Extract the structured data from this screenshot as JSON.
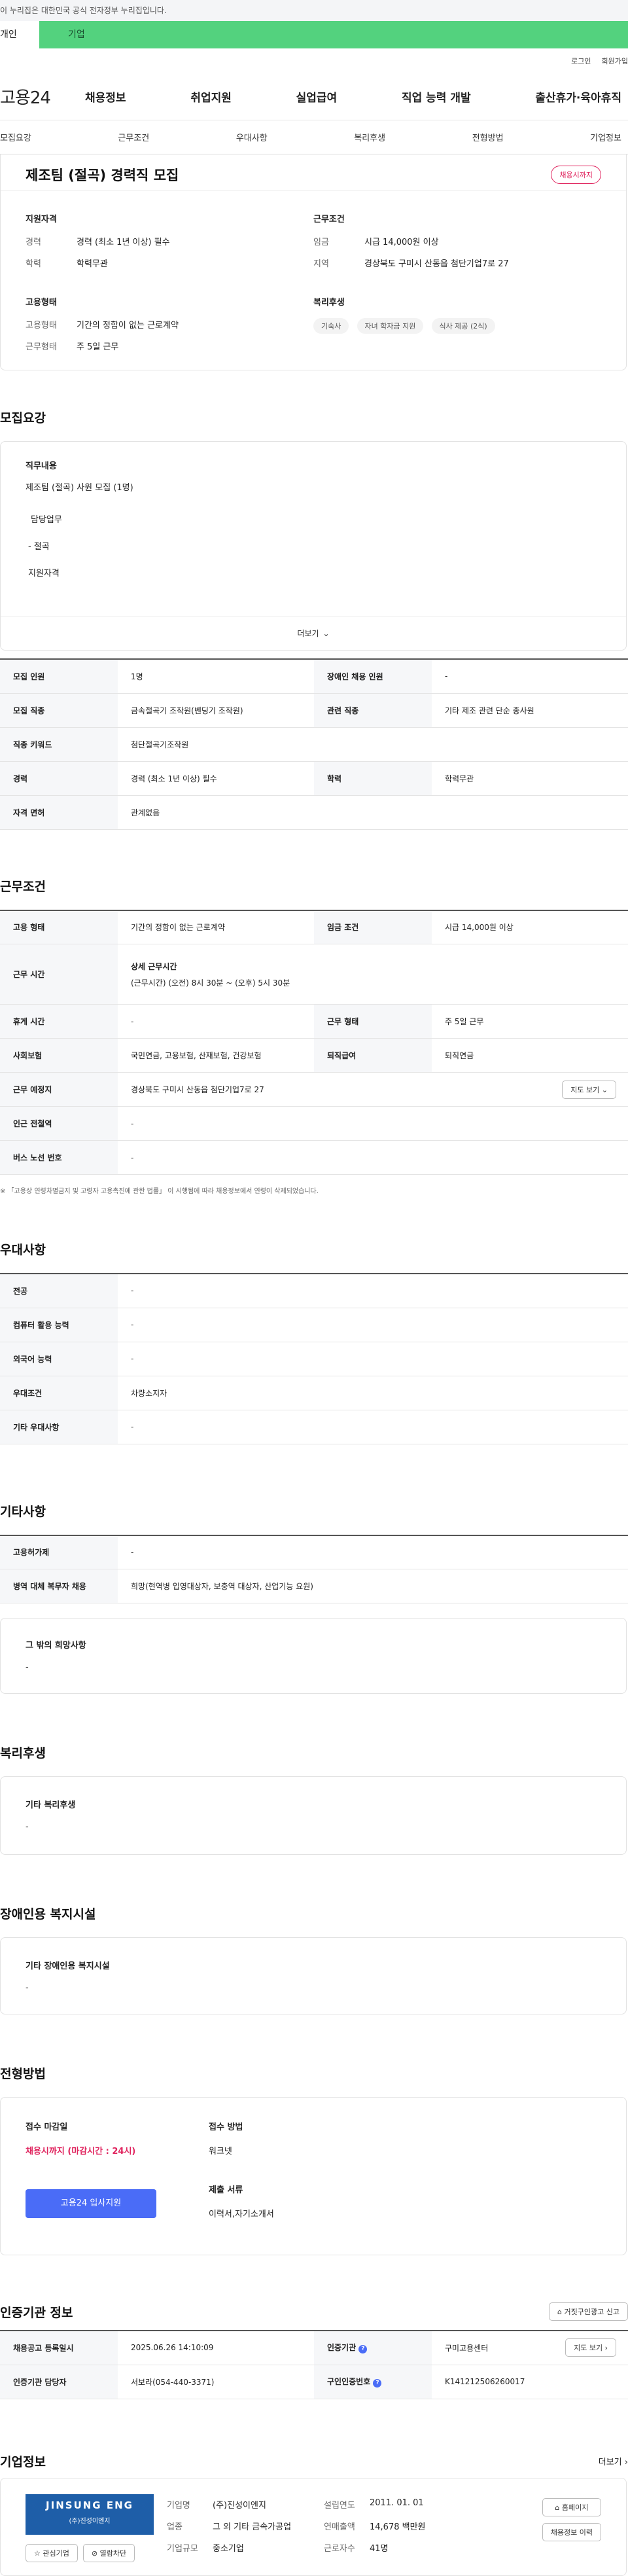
{
  "gov_banner": "이 누리집은 대한민국 공식 전자정부 누리집입니다.",
  "user_tabs": [
    "개인",
    "기업"
  ],
  "top_links": [
    "로그인",
    "회원가입"
  ],
  "logo": "고용24",
  "gnb": [
    "채용정보",
    "취업지원",
    "실업급여",
    "직업 능력 개발",
    "출산휴가·육아휴직"
  ],
  "page_tabs": [
    "모집요강",
    "근무조건",
    "우대사항",
    "복리후생",
    "전형방법",
    "기업정보"
  ],
  "summary": {
    "title": "제조팀 (절곡) 경력직 모집",
    "status": "채용시까지",
    "qual_title": "지원자격",
    "qual_rows": [
      [
        "경력",
        "경력 (최소 1년 이상) 필수"
      ],
      [
        "학력",
        "학력무관"
      ]
    ],
    "emp_title": "고용형태",
    "emp_rows": [
      [
        "고용형태",
        "기간의 정함이 없는 근로계약"
      ],
      [
        "근무형태",
        "주 5일 근무"
      ]
    ],
    "cond_title": "근무조건",
    "cond_rows": [
      [
        "임금",
        "시급 14,000원 이상"
      ],
      [
        "지역",
        "경상북도 구미시 산동읍 첨단기업7로 27"
      ]
    ],
    "welfare_title": "복리후생",
    "welfare_badges": [
      "기숙사",
      "자녀 학자금 지원",
      "식사 제공 (2식)"
    ]
  },
  "recruit": {
    "title": "모집요강",
    "duty_title": "직무내용",
    "duty_text": "제조팀 (절곡) 사원 모집  (1명)",
    "duty_lines": [
      "담당업무",
      "- 절곡",
      "지원자격"
    ],
    "more": "더보기",
    "rows": [
      [
        "모집 인원",
        "1명",
        "장애인 채용 인원",
        "-"
      ],
      [
        "모집 직종",
        "금속절곡기 조작원(벤딩기 조작원)",
        "관련 직종",
        "기타 제조 관련 단순 종사원"
      ],
      [
        "직종 키워드",
        "첨단절곡기조작원"
      ],
      [
        "경력",
        "경력 (최소 1년 이상) 필수",
        "학력",
        "학력무관"
      ],
      [
        "자격 면허",
        "관계없음"
      ]
    ]
  },
  "work": {
    "title": "근무조건",
    "row1": [
      "고용 형태",
      "기간의 정함이 없는 근로계약",
      "임금 조건",
      "시급 14,000원 이상"
    ],
    "hours_label": "근무 시간",
    "hours_title": "상세 근무시간",
    "hours_text": "(근무시간) (오전) 8시 30분 ~ (오후) 5시 30분",
    "row3": [
      "휴게 시간",
      "-",
      "근무 형태",
      "주 5일 근무"
    ],
    "row4": [
      "사회보험",
      "국민연금, 고용보험, 산재보험, 건강보험",
      "퇴직급여",
      "퇴직연금"
    ],
    "place_label": "근무 예정지",
    "place_value": "경상북도 구미시 산동읍 첨단기업7로 27",
    "map_btn": "지도 보기",
    "row6": [
      "인근 전철역",
      "-"
    ],
    "row7": [
      "버스 노선 번호",
      "-"
    ],
    "note": "※ 「고용상 연령차별금지 및 고령자 고용촉진에 관한 법률」 이 시행됨에 따라 채용정보에서 연령이 삭제되었습니다."
  },
  "pref": {
    "title": "우대사항",
    "rows": [
      [
        "전공",
        "-"
      ],
      [
        "컴퓨터 활용 능력",
        "-"
      ],
      [
        "외국어 능력",
        "-"
      ],
      [
        "우대조건",
        "차량소지자"
      ],
      [
        "기타 우대사항",
        "-"
      ]
    ]
  },
  "etc": {
    "title": "기타사항",
    "rows": [
      [
        "고용허가제",
        "-"
      ],
      [
        "병역 대체 복무자 채용",
        "희망(현역병 입영대상자, 보충역 대상자, 산업기능 요원)"
      ]
    ],
    "box_title": "그 밖의 희망사항",
    "box_value": "-"
  },
  "welfare": {
    "title": "복리후생",
    "box_title": "기타 복리후생",
    "box_value": "-"
  },
  "disabled": {
    "title": "장애인용 복지시설",
    "box_title": "기타 장애인용 복지시설",
    "box_value": "-"
  },
  "selection": {
    "title": "전형방법",
    "deadline_label": "접수 마감일",
    "deadline_value": "채용시까지 (마감시간 : 24시)",
    "apply_btn": "고용24 입사지원",
    "method_label": "접수 방법",
    "method_value": "워크넷",
    "docs_label": "제출 서류",
    "docs_value": "이력서,자기소개서"
  },
  "agency": {
    "title": "인증기관 정보",
    "report_btn": "거짓구인광고 신고",
    "rows": [
      [
        "채용공고 등록일시",
        "2025.06.26 14:10:09",
        "인증기관",
        "구미고용센터"
      ],
      [
        "인증기관 담당자",
        "서보라(054-440-3371)",
        "구인인증번호",
        "K141212506260017"
      ]
    ],
    "map_btn": "지도 보기"
  },
  "company": {
    "title": "기업정보",
    "more": "더보기",
    "logo_text": "JINSUNG ENG",
    "logo_sub": "(주)진성이엔지",
    "fav_btn": "관심기업",
    "block_btn": "열람차단",
    "rows": [
      [
        "기업명",
        "(주)진성이엔지",
        "설립연도",
        "2011. 01. 01"
      ],
      [
        "업종",
        "그 외 기타 금속가공업",
        "연매출액",
        "14,678 백만원"
      ],
      [
        "기업규모",
        "중소기업",
        "근로자수",
        "41명"
      ]
    ],
    "home_btn": "홈페이지",
    "history_btn": "채용정보 이력"
  }
}
